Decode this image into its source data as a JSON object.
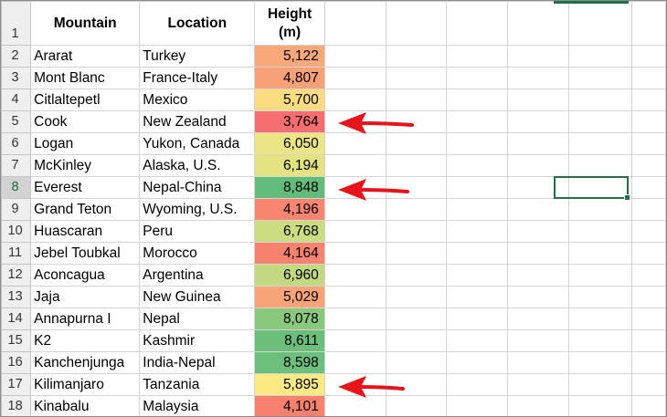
{
  "sheet": {
    "headers": {
      "mountain": "Mountain",
      "location": "Location",
      "height_line1": "Height",
      "height_line2": "(m)"
    },
    "header_row_number": "1",
    "rows": [
      {
        "rownum": "2",
        "mountain": "Ararat",
        "location": "Turkey",
        "height": "5,122",
        "color": "#F9A87A"
      },
      {
        "rownum": "3",
        "mountain": "Mont Blanc",
        "location": "France-Italy",
        "height": "4,807",
        "color": "#F8A077"
      },
      {
        "rownum": "4",
        "mountain": "Citlaltepetl",
        "location": "Mexico",
        "height": "5,700",
        "color": "#FBDC80"
      },
      {
        "rownum": "5",
        "mountain": "Cook",
        "location": "New Zealand",
        "height": "3,764",
        "color": "#F66E6F"
      },
      {
        "rownum": "6",
        "mountain": "Logan",
        "location": "Yukon, Canada",
        "height": "6,050",
        "color": "#EBE583"
      },
      {
        "rownum": "7",
        "mountain": "McKinley",
        "location": "Alaska, U.S.",
        "height": "6,194",
        "color": "#E4E382"
      },
      {
        "rownum": "8",
        "mountain": "Everest",
        "location": "Nepal-China",
        "height": "8,848",
        "color": "#62BC7B"
      },
      {
        "rownum": "9",
        "mountain": "Grand Teton",
        "location": "Wyoming, U.S.",
        "height": "4,196",
        "color": "#F7856F"
      },
      {
        "rownum": "10",
        "mountain": "Huascaran",
        "location": "Peru",
        "height": "6,768",
        "color": "#CBDC81"
      },
      {
        "rownum": "11",
        "mountain": "Jebel Toubkal",
        "location": "Morocco",
        "height": "4,164",
        "color": "#F7826F"
      },
      {
        "rownum": "12",
        "mountain": "Aconcagua",
        "location": "Argentina",
        "height": "6,960",
        "color": "#C2D980"
      },
      {
        "rownum": "13",
        "mountain": "Jaja",
        "location": "New Guinea",
        "height": "5,029",
        "color": "#F9A478"
      },
      {
        "rownum": "14",
        "mountain": "Annapurna I",
        "location": "Nepal",
        "height": "8,078",
        "color": "#88C97E"
      },
      {
        "rownum": "15",
        "mountain": "K2",
        "location": "Kashmir",
        "height": "8,611",
        "color": "#6BBF7B"
      },
      {
        "rownum": "16",
        "mountain": "Kanchenjunga",
        "location": "India-Nepal",
        "height": "8,598",
        "color": "#6CBF7C"
      },
      {
        "rownum": "17",
        "mountain": "Kilimanjaro",
        "location": "Tanzania",
        "height": "5,895",
        "color": "#FBE983"
      },
      {
        "rownum": "18",
        "mountain": "Kinabalu",
        "location": "Malaysia",
        "height": "4,101",
        "color": "#F7806E"
      }
    ],
    "selected_row": "8",
    "accent_color": "#217346",
    "arrow_color": "#E8141B"
  }
}
